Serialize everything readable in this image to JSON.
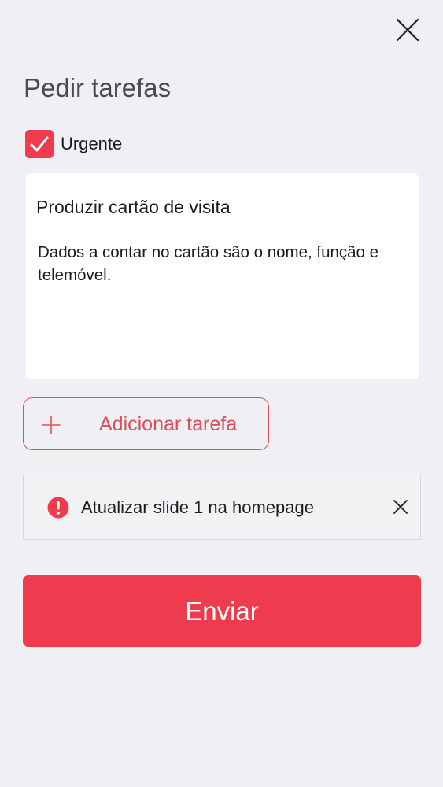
{
  "header": {
    "title": "Pedir tarefas",
    "close_icon": "close-icon"
  },
  "urgent": {
    "label": "Urgente",
    "checked": true,
    "color": "#ef3b4e"
  },
  "task": {
    "title": "Produzir cartão de visita",
    "description": "Dados a contar no cartão são o nome, função e telemóvel."
  },
  "add_task": {
    "label": "Adicionar tarefa",
    "icon": "plus-icon"
  },
  "tasks_list": [
    {
      "text": "Atualizar slide 1 na homepage",
      "icon": "alert-icon",
      "remove_icon": "close-icon"
    }
  ],
  "submit": {
    "label": "Enviar",
    "color": "#ef3b4e"
  }
}
